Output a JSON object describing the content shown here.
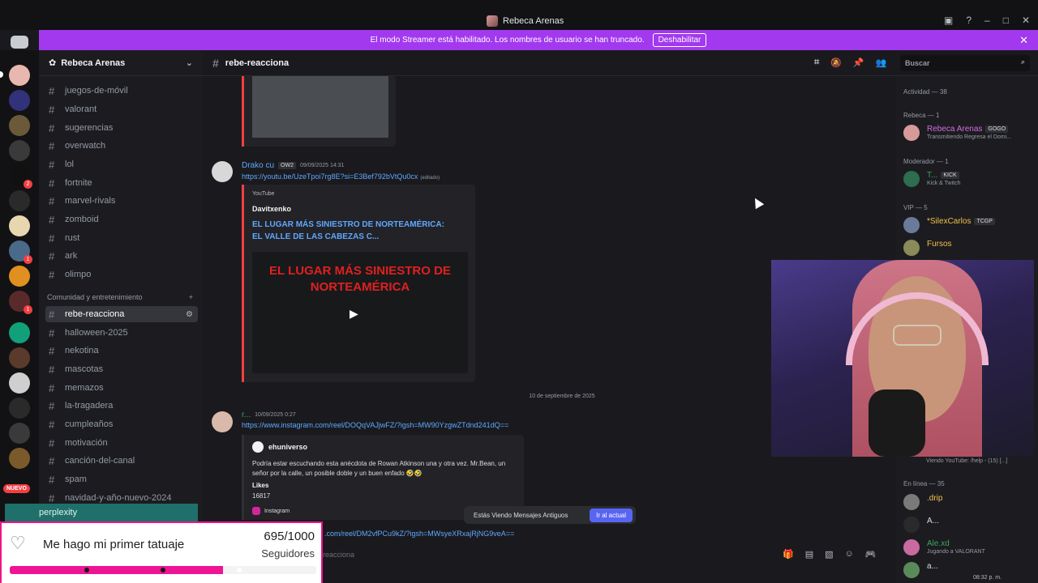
{
  "window": {
    "title": "Rebeca Arenas"
  },
  "banner": {
    "text": "El modo Streamer está habilitado. Los nombres de usuario se han truncado.",
    "button": "Deshabilitar"
  },
  "guild": {
    "name": "Rebeca Arenas"
  },
  "channels": [
    "juegos-de-móvil",
    "valorant",
    "sugerencias",
    "overwatch",
    "lol",
    "fortnite",
    "marvel-rivals",
    "zomboid",
    "rust",
    "ark",
    "olimpo"
  ],
  "category": {
    "name": "Comunidad y entretenimiento"
  },
  "channels2": [
    "rebe-reacciona",
    "halloween-2025",
    "nekotina",
    "mascotas",
    "memazos",
    "la-tragadera",
    "cumpleaños",
    "motivación",
    "canción-del-canal",
    "spam",
    "navidad-y-año-nuevo-2024"
  ],
  "server_badges": {
    "nuevo": "NUEVO"
  },
  "header": {
    "channel": "rebe-reacciona",
    "search_placeholder": "Buscar"
  },
  "messages": {
    "m1": {
      "author": "Drako cu",
      "tag": "OW2",
      "time": "09/09/2025 14:31",
      "link": "https://youtu.be/UzeTpoi7rg8E?si=E3Bef792bVtQu0cx",
      "edited": "(editado)",
      "provider": "YouTube",
      "embed_author": "Davitxenko",
      "embed_title": "EL LUGAR MÁS SINIESTRO DE NORTEAMÉRICA: EL VALLE DE LAS CABEZAS C...",
      "video_text": "EL LUGAR MÁS SINIESTRO DE NORTEAMÉRICA"
    },
    "divider": "10 de septiembre de 2025",
    "m2": {
      "author": "r...",
      "time": "10/09/2025 0:27",
      "link": "https://www.instagram.com/reel/DOQqVAJjwFZ/?igsh=MW90YzgwZTdnd241dQ==",
      "ig_author": "ehuniverso",
      "desc": "Podría estar escuchando esta anécdota de Rowan Atkinson una y otra vez. Mr.Bean, un señor por la calle, un posible doble y un buen enfado 🤣🤣",
      "likes_label": "Likes",
      "likes": "16817",
      "footer": "Instagram",
      "link2": ".com/reel/DM2vfPCu9kZ/?igsh=MWsyeXRxajRjNG9veA=="
    },
    "old_notice": "Estás Viendo Mensajes Antiguos",
    "jump": "Ir al actual"
  },
  "composer": {
    "placeholder": "e-reacciona"
  },
  "members": {
    "activity": "Actividad — 38",
    "sec_rebeca": "Rebeca — 1",
    "rebeca": {
      "name": "Rebeca Arenas",
      "tag": "GOGO",
      "status": "Transmitiendo Regresa el Domi..."
    },
    "sec_mod": "Moderador — 1",
    "mod": {
      "name": "T...",
      "tag": "KICK",
      "status": "Kick & Twitch"
    },
    "sec_vip": "VIP — 5",
    "vip1": {
      "name": "*SilexCarlos",
      "tag": "TCGP"
    },
    "vip2": {
      "name": "Fursos"
    },
    "hidden_status": "Viendo YouTube: /help - (15) [...]",
    "sec_online": "En línea — 35",
    "o1": {
      "name": ".drip"
    },
    "o2": {
      "name": "A..."
    },
    "o3": {
      "name": "Ale.xd",
      "status": "Jugando a VALORANT"
    },
    "o4": {
      "name": "a..."
    }
  },
  "goal": {
    "label": "Me hago mi primer tatuaje",
    "count": "695/1000",
    "sub": "Seguidores",
    "progress": 0.695
  },
  "overlay": {
    "app": "perplexity"
  },
  "clock": "08:32 p. m.",
  "colors": {
    "accent": "#a239ee",
    "link": "#5fa8ff",
    "danger": "#f23f43",
    "goal_fill": "#ee1493"
  }
}
